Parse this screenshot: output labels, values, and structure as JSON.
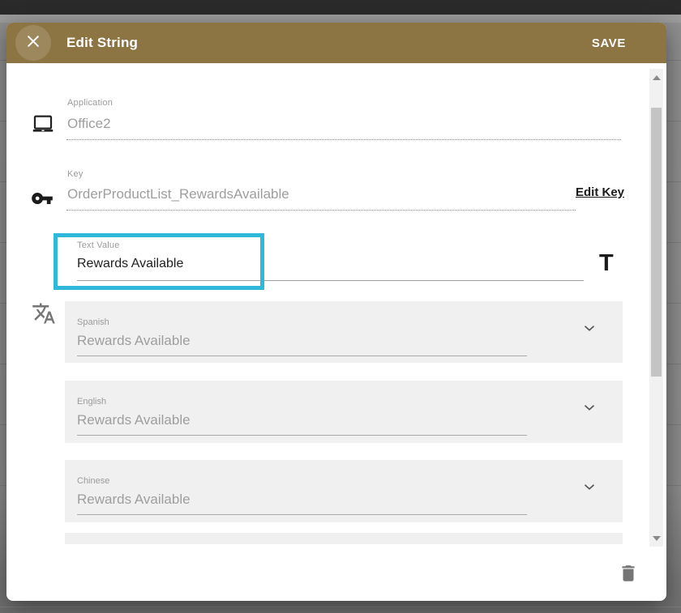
{
  "window": {
    "title": "Edit String",
    "save_label": "SAVE"
  },
  "form": {
    "application": {
      "label": "Application",
      "value": "Office2"
    },
    "key": {
      "label": "Key",
      "value": "OrderProductList_RewardsAvailable",
      "edit_link": "Edit Key"
    },
    "text_value": {
      "label": "Text Value",
      "value": "Rewards Available",
      "format_icon_glyph": "T"
    }
  },
  "translations": [
    {
      "language": "Spanish",
      "value": "Rewards Available"
    },
    {
      "language": "English",
      "value": "Rewards Available"
    },
    {
      "language": "Chinese",
      "value": "Rewards Available"
    }
  ],
  "icons": {
    "close": "close-icon",
    "application": "laptop-icon",
    "key": "key-icon",
    "translate": "translate-icon",
    "text_format": "text-format-icon",
    "expand": "chevron-down-icon",
    "delete": "trash-icon"
  },
  "colors": {
    "header_accent": "#8d7443",
    "highlight_border": "#2fb8d9",
    "field_text_gray": "#9e9e9e",
    "section_background": "#f0f0f0"
  }
}
